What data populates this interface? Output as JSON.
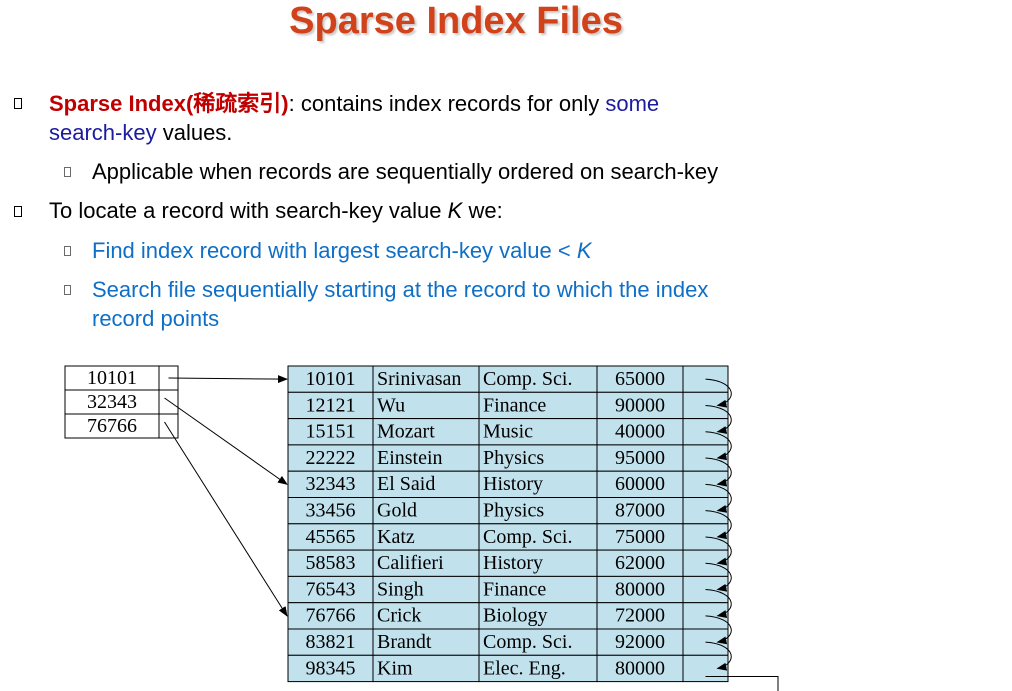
{
  "slide": {
    "title": "Sparse Index Files",
    "bullet1": {
      "term": "Sparse Index",
      "term_cn": "(稀疏索引)",
      "colon": ":",
      "text_a": " contains index records for only ",
      "text_some": "some",
      "text_searchkey": "search-key",
      "text_values": " values."
    },
    "sub1": "Applicable when records are sequentially ordered on search-key",
    "bullet2": {
      "text": "To locate a record with search-key value ",
      "var": "K",
      "text_end": " we:"
    },
    "sub2": {
      "text": "Find index record with largest search-key value < ",
      "var": "K"
    },
    "sub3": {
      "line1": "Search file sequentially starting at the record to which the index",
      "line2": "record points"
    }
  },
  "figure": {
    "index_records": [
      "10101",
      "32343",
      "76766"
    ],
    "data_records": [
      [
        "10101",
        "Srinivasan",
        "Comp. Sci.",
        "65000"
      ],
      [
        "12121",
        "Wu",
        "Finance",
        "90000"
      ],
      [
        "15151",
        "Mozart",
        "Music",
        "40000"
      ],
      [
        "22222",
        "Einstein",
        "Physics",
        "95000"
      ],
      [
        "32343",
        "El Said",
        "History",
        "60000"
      ],
      [
        "33456",
        "Gold",
        "Physics",
        "87000"
      ],
      [
        "45565",
        "Katz",
        "Comp. Sci.",
        "75000"
      ],
      [
        "58583",
        "Califieri",
        "History",
        "62000"
      ],
      [
        "76543",
        "Singh",
        "Finance",
        "80000"
      ],
      [
        "76766",
        "Crick",
        "Biology",
        "72000"
      ],
      [
        "83821",
        "Brandt",
        "Comp. Sci.",
        "92000"
      ],
      [
        "98345",
        "Kim",
        "Elec. Eng.",
        "80000"
      ]
    ],
    "pointer_targets": [
      0,
      4,
      9
    ],
    "colors": {
      "data_fill": "#c1e1ec",
      "title": "#d1421b"
    }
  }
}
